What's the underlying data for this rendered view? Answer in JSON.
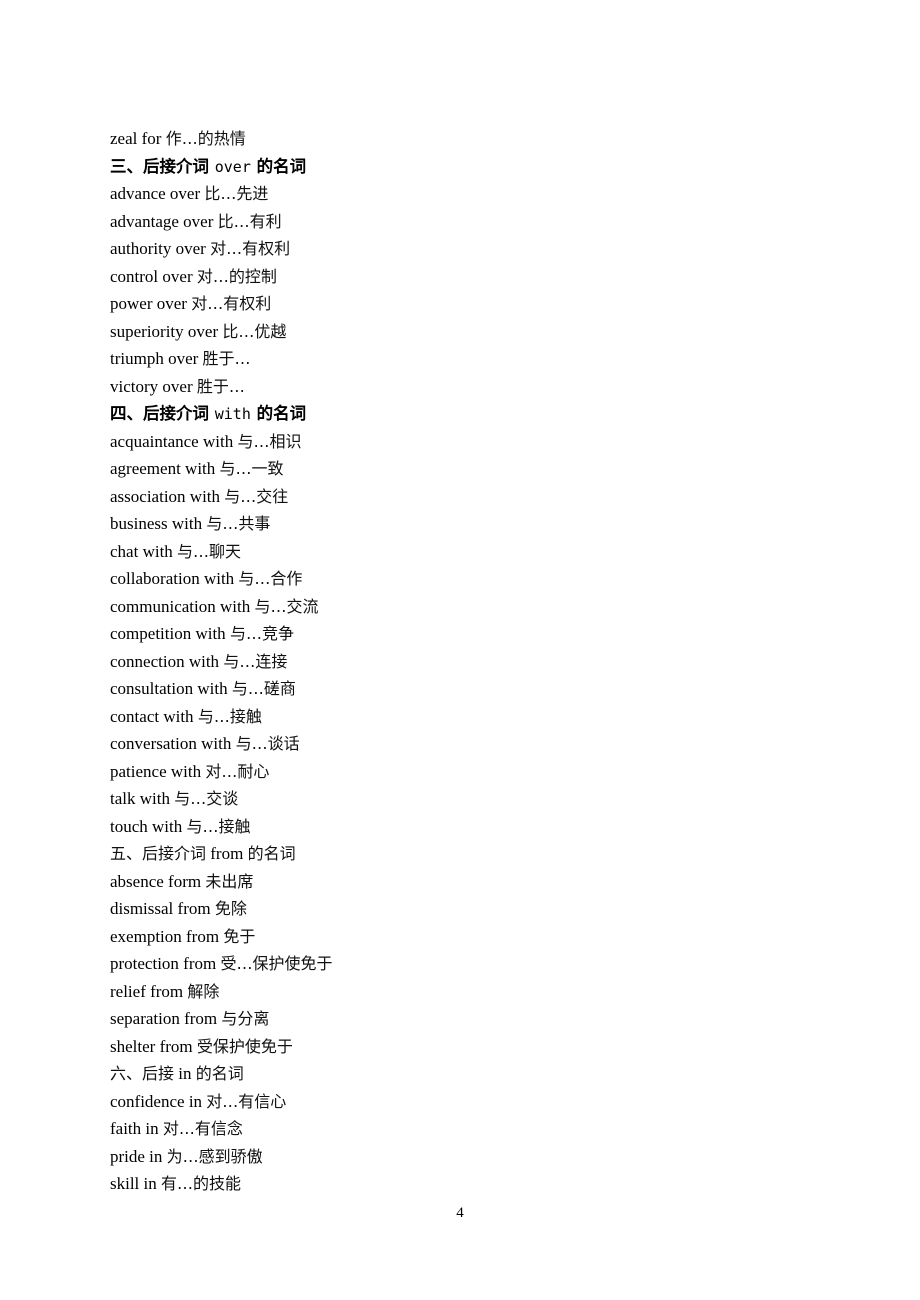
{
  "document": {
    "lines": [
      {
        "type": "entry",
        "en": "zeal for",
        "zh": "作…的热情"
      },
      {
        "type": "heading-bold",
        "prefix": "三、后接介词",
        "en": "over",
        "suffix": "的名词"
      },
      {
        "type": "entry",
        "en": "advance over",
        "zh": "比…先进"
      },
      {
        "type": "entry",
        "en": "advantage over",
        "zh": "比…有利"
      },
      {
        "type": "entry",
        "en": "authority over",
        "zh": "对…有权利"
      },
      {
        "type": "entry",
        "en": "control over",
        "zh": "对…的控制"
      },
      {
        "type": "entry",
        "en": "power over",
        "zh": "对…有权利"
      },
      {
        "type": "entry",
        "en": "superiority over",
        "zh": "比…优越"
      },
      {
        "type": "entry",
        "en": "triumph over",
        "zh": "胜于…"
      },
      {
        "type": "entry",
        "en": "victory over",
        "zh": "胜于…"
      },
      {
        "type": "heading-bold",
        "prefix": "四、后接介词",
        "en": "with",
        "suffix": "的名词"
      },
      {
        "type": "entry",
        "en": "acquaintance with",
        "zh": "与…相识"
      },
      {
        "type": "entry",
        "en": "agreement with",
        "zh": "与…一致"
      },
      {
        "type": "entry",
        "en": "association with",
        "zh": "与…交往"
      },
      {
        "type": "entry",
        "en": "business with",
        "zh": "与…共事"
      },
      {
        "type": "entry",
        "en": "chat with",
        "zh": "与…聊天"
      },
      {
        "type": "entry",
        "en": "collaboration with",
        "zh": "与…合作"
      },
      {
        "type": "entry",
        "en": "communication with",
        "zh": "与…交流"
      },
      {
        "type": "entry",
        "en": "competition with",
        "zh": "与…竞争"
      },
      {
        "type": "entry",
        "en": "connection with",
        "zh": "与…连接"
      },
      {
        "type": "entry",
        "en": "consultation with",
        "zh": "与…磋商"
      },
      {
        "type": "entry",
        "en": "contact with",
        "zh": "与…接触"
      },
      {
        "type": "entry",
        "en": "conversation with",
        "zh": "与…谈话"
      },
      {
        "type": "entry",
        "en": "patience with",
        "zh": "对…耐心"
      },
      {
        "type": "entry",
        "en": "talk with",
        "zh": "与…交谈"
      },
      {
        "type": "entry",
        "en": "touch with",
        "zh": "与…接触"
      },
      {
        "type": "heading-plain",
        "prefix": "五、后接介词",
        "en": "from",
        "suffix": "的名词"
      },
      {
        "type": "entry",
        "en": "absence form",
        "zh": "未出席"
      },
      {
        "type": "entry",
        "en": "dismissal from",
        "zh": "免除"
      },
      {
        "type": "entry",
        "en": "exemption from",
        "zh": "免于"
      },
      {
        "type": "entry",
        "en": "protection from",
        "zh": "受…保护使免于"
      },
      {
        "type": "entry",
        "en": "relief from",
        "zh": "解除"
      },
      {
        "type": "entry",
        "en": "separation from",
        "zh": "与分离"
      },
      {
        "type": "entry",
        "en": "shelter from",
        "zh": "受保护使免于"
      },
      {
        "type": "heading-plain",
        "prefix": "六、后接",
        "en": "in",
        "suffix": "的名词"
      },
      {
        "type": "entry",
        "en": "confidence in",
        "zh": "对…有信心"
      },
      {
        "type": "entry",
        "en": "faith in",
        "zh": "对…有信念"
      },
      {
        "type": "entry",
        "en": "pride in",
        "zh": "为…感到骄傲"
      },
      {
        "type": "entry",
        "en": "skill in",
        "zh": "有…的技能"
      }
    ],
    "page_number": "4"
  }
}
